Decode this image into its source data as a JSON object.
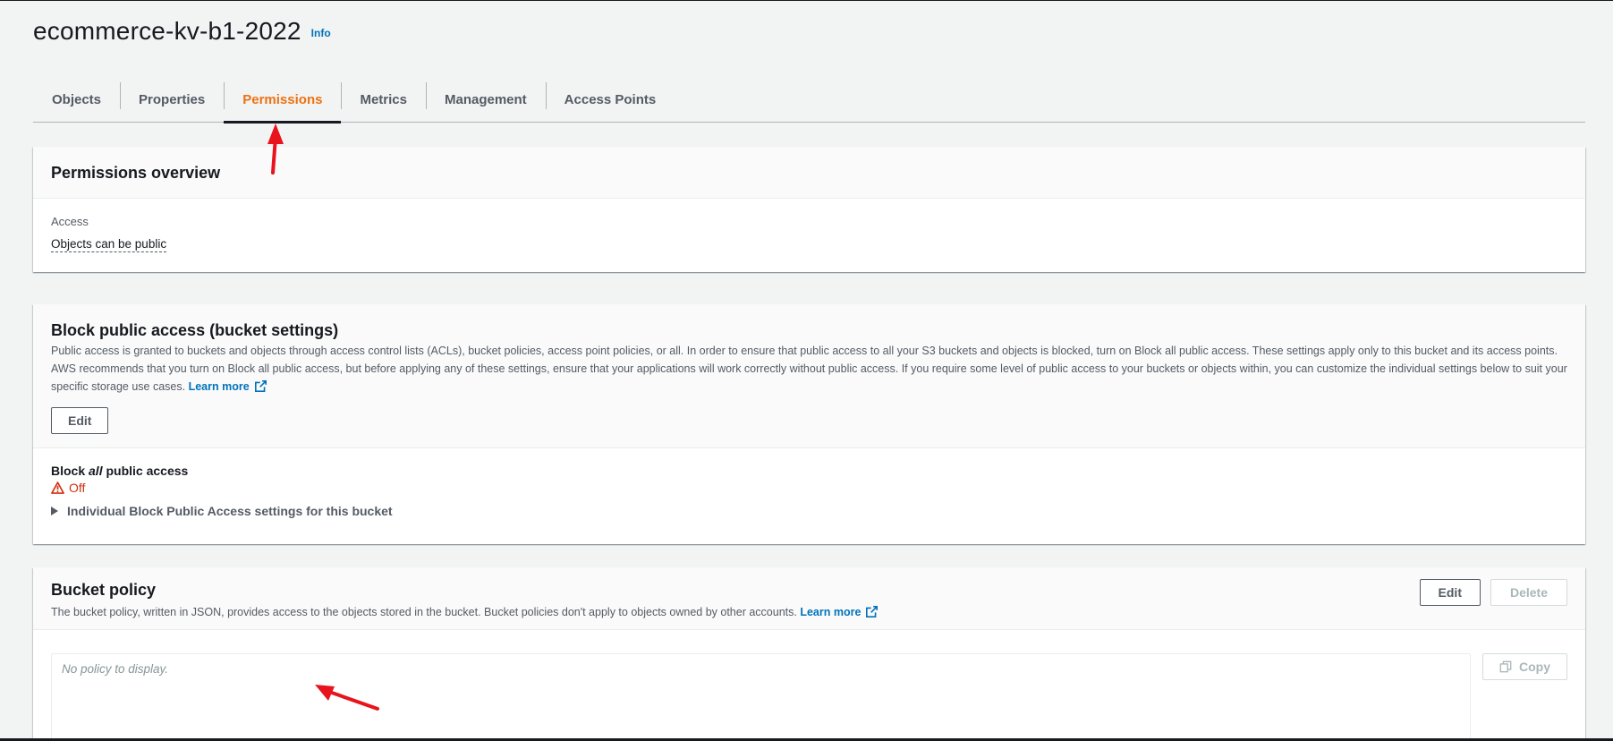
{
  "header": {
    "title": "ecommerce-kv-b1-2022",
    "info_label": "Info"
  },
  "tabs": [
    {
      "label": "Objects",
      "active": false
    },
    {
      "label": "Properties",
      "active": false
    },
    {
      "label": "Permissions",
      "active": true
    },
    {
      "label": "Metrics",
      "active": false
    },
    {
      "label": "Management",
      "active": false
    },
    {
      "label": "Access Points",
      "active": false
    }
  ],
  "permissions_overview": {
    "title": "Permissions overview",
    "access_label": "Access",
    "access_value": "Objects can be public"
  },
  "block_public_access": {
    "title": "Block public access (bucket settings)",
    "description": "Public access is granted to buckets and objects through access control lists (ACLs), bucket policies, access point policies, or all. In order to ensure that public access to all your S3 buckets and objects is blocked, turn on Block all public access. These settings apply only to this bucket and its access points. AWS recommends that you turn on Block all public access, but before applying any of these settings, ensure that your applications will work correctly without public access. If you require some level of public access to your buckets or objects within, you can customize the individual settings below to suit your specific storage use cases.",
    "learn_more": "Learn more",
    "edit_label": "Edit",
    "setting_prefix": "Block ",
    "setting_emphasis": "all",
    "setting_suffix": " public access",
    "status": "Off",
    "expander_label": "Individual Block Public Access settings for this bucket"
  },
  "bucket_policy": {
    "title": "Bucket policy",
    "description": "The bucket policy, written in JSON, provides access to the objects stored in the bucket. Bucket policies don't apply to objects owned by other accounts.",
    "learn_more": "Learn more",
    "edit_label": "Edit",
    "delete_label": "Delete",
    "copy_label": "Copy",
    "empty_text": "No policy to display."
  },
  "colors": {
    "accent_tab": "#ec7211",
    "link": "#0073bb",
    "warning": "#d13212",
    "annotation": "#e8131c"
  },
  "icons": [
    "external-link-icon",
    "warning-icon",
    "caret-right-icon",
    "copy-icon"
  ]
}
